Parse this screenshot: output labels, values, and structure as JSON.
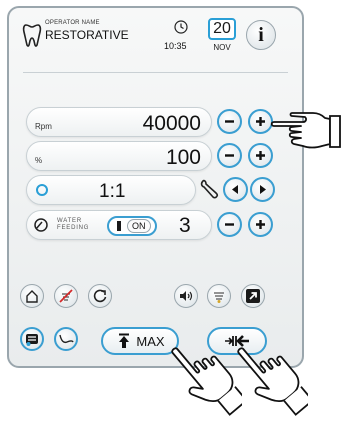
{
  "header": {
    "operator_label": "OPERATOR NAME",
    "operator_value": "RESTORATIVE",
    "time": "10:35",
    "date_day": "20",
    "date_month": "NOV",
    "info_label": "i"
  },
  "settings": {
    "rpm": {
      "label": "Rpm",
      "value": "40000"
    },
    "percent": {
      "label": "%",
      "value": "100"
    },
    "ratio": {
      "value": "1:1"
    },
    "water": {
      "label_line1": "WATER",
      "label_line2": "FEEDING",
      "toggle_label": "ON",
      "value": "3"
    }
  },
  "bottom": {
    "max_label": "MAX"
  },
  "colors": {
    "accent": "#2a9fd6",
    "border": "#9aa6ad",
    "background": "#eef1f2"
  },
  "icons": [
    "tooth-icon",
    "clock-icon",
    "info-icon",
    "minus-icon",
    "plus-icon",
    "wrench-icon",
    "arrow-left-icon",
    "arrow-right-icon",
    "home-icon",
    "no-light-icon",
    "rotate-icon",
    "speaker-icon",
    "light-icon",
    "jump-arrow-icon",
    "menu-icon",
    "curve-icon",
    "max-arrow-icon",
    "reset-icon",
    "pointing-hand-icon"
  ]
}
